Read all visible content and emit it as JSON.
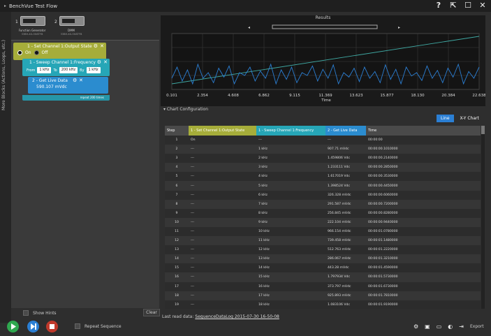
{
  "window": {
    "title": "BenchVue Test Flow"
  },
  "instruments": [
    {
      "num": "1",
      "name": "Function Generator",
      "serial": "33BH-XX-ONSTFB"
    },
    {
      "num": "2",
      "name": "DMM",
      "serial": "33BH-XX-ONSTFB"
    }
  ],
  "sidebar_tab": "More Blocks (Actions, Loops, etc.)",
  "blocks": {
    "b1": {
      "label": "1 - Set Channel 1:Output State",
      "on": "On",
      "off": "Off"
    },
    "b2": {
      "label": "1 - Sweep Channel 1:Frequency",
      "from_lbl": "From",
      "from": "1 kHz",
      "to_lbl": "To",
      "to": "200 kHz",
      "by_lbl": "By",
      "by": "1 kHz"
    },
    "b3": {
      "label": "2 - Get Live Data",
      "value": "590.107 mVdc"
    },
    "repeat": "repeat 200 times"
  },
  "show_hints": "Show Hints",
  "clear": "Clear",
  "repeat_sequence": "Repeat Sequence",
  "results": {
    "title": "Results",
    "xlabel": "Time"
  },
  "chart_data": {
    "type": "line",
    "xlabel": "Time",
    "ticks": [
      "0.101",
      "2.354",
      "4.608",
      "6.862",
      "9.115",
      "11.369",
      "13.623",
      "15.877",
      "18.130",
      "20.384",
      "22.638"
    ],
    "xlim": [
      0.101,
      22.638
    ],
    "series": [
      {
        "color": "#3fa9a3",
        "values": [
          0.1,
          0.95
        ]
      },
      {
        "color": "#2b7fd4",
        "values": [
          0.2,
          0.4,
          0.15,
          0.35,
          0.1,
          0.45,
          0.2,
          0.3,
          0.12,
          0.38,
          0.22,
          0.42,
          0.1,
          0.3,
          0.25,
          0.4,
          0.15,
          0.33,
          0.2,
          0.45,
          0.1,
          0.35,
          0.18,
          0.4,
          0.12,
          0.3,
          0.25,
          0.42,
          0.15,
          0.36,
          0.2,
          0.44,
          0.1,
          0.3,
          0.22,
          0.38,
          0.14,
          0.4,
          0.2,
          0.32,
          0.12,
          0.44,
          0.18,
          0.36,
          0.1,
          0.4,
          0.24,
          0.3,
          0.16,
          0.42,
          0.2,
          0.34,
          0.12,
          0.38,
          0.22,
          0.45,
          0.1,
          0.32,
          0.2,
          0.4
        ]
      }
    ]
  },
  "chart_config": "Chart Configuration",
  "view": {
    "line": "Line",
    "xy": "X-Y Chart"
  },
  "table": {
    "headers": [
      "Step",
      "1 - Set Channel 1:Output State",
      "1 - Sweep Channel 1:Frequency",
      "2 - Get Live Data",
      "Time"
    ],
    "header_colors": [
      "#4a4a4a",
      "#a6ad3a",
      "#26a6b7",
      "#2b8ccf",
      "#4a4a4a"
    ],
    "rows": [
      [
        "1",
        "On",
        "---",
        "---",
        "00:00:00"
      ],
      [
        "2",
        "---",
        "1 kHz",
        "907.71 mVdc",
        "00:00:00.1010000"
      ],
      [
        "3",
        "---",
        "2 kHz",
        "1.459806 Vdc",
        "00:00:00.2140000"
      ],
      [
        "4",
        "---",
        "3 kHz",
        "1.233111 Vdc",
        "00:00:00.2850000"
      ],
      [
        "5",
        "---",
        "4 kHz",
        "1.617019 Vdc",
        "00:00:00.3530000"
      ],
      [
        "6",
        "---",
        "5 kHz",
        "1.398524 Vdc",
        "00:00:00.4450000"
      ],
      [
        "7",
        "---",
        "6 kHz",
        "326.328 mVdc",
        "00:00:00.6060000"
      ],
      [
        "8",
        "---",
        "7 kHz",
        "291.587 mVdc",
        "00:00:00.7200000"
      ],
      [
        "9",
        "---",
        "8 kHz",
        "256.845 mVdc",
        "00:00:00.8280000"
      ],
      [
        "10",
        "---",
        "9 kHz",
        "222.104 mVdc",
        "00:00:00.9440000"
      ],
      [
        "11",
        "---",
        "10 kHz",
        "966.154 mVdc",
        "00:00:01.0780000"
      ],
      [
        "12",
        "---",
        "11 kHz",
        "739.458 mVdc",
        "00:00:01.1480000"
      ],
      [
        "13",
        "---",
        "12 kHz",
        "512.763 mVdc",
        "00:00:01.2220000"
      ],
      [
        "14",
        "---",
        "13 kHz",
        "286.067 mVdc",
        "00:00:01.3210000"
      ],
      [
        "15",
        "---",
        "14 kHz",
        "443.28 mVdc",
        "00:00:01.4590000"
      ],
      [
        "16",
        "---",
        "15 kHz",
        "1.797934 Vdc",
        "00:00:01.5730000"
      ],
      [
        "17",
        "---",
        "16 kHz",
        "373.797 mVdc",
        "00:00:01.6730000"
      ],
      [
        "18",
        "---",
        "17 kHz",
        "925.893 mVdc",
        "00:00:01.7810000"
      ],
      [
        "19",
        "---",
        "18 kHz",
        "1.083106 Vdc",
        "00:00:01.9190000"
      ]
    ]
  },
  "last_read": {
    "label": "Last read data:",
    "value": "SequenceDataLog 2015-07-30 16-50-08"
  },
  "export": "Export"
}
